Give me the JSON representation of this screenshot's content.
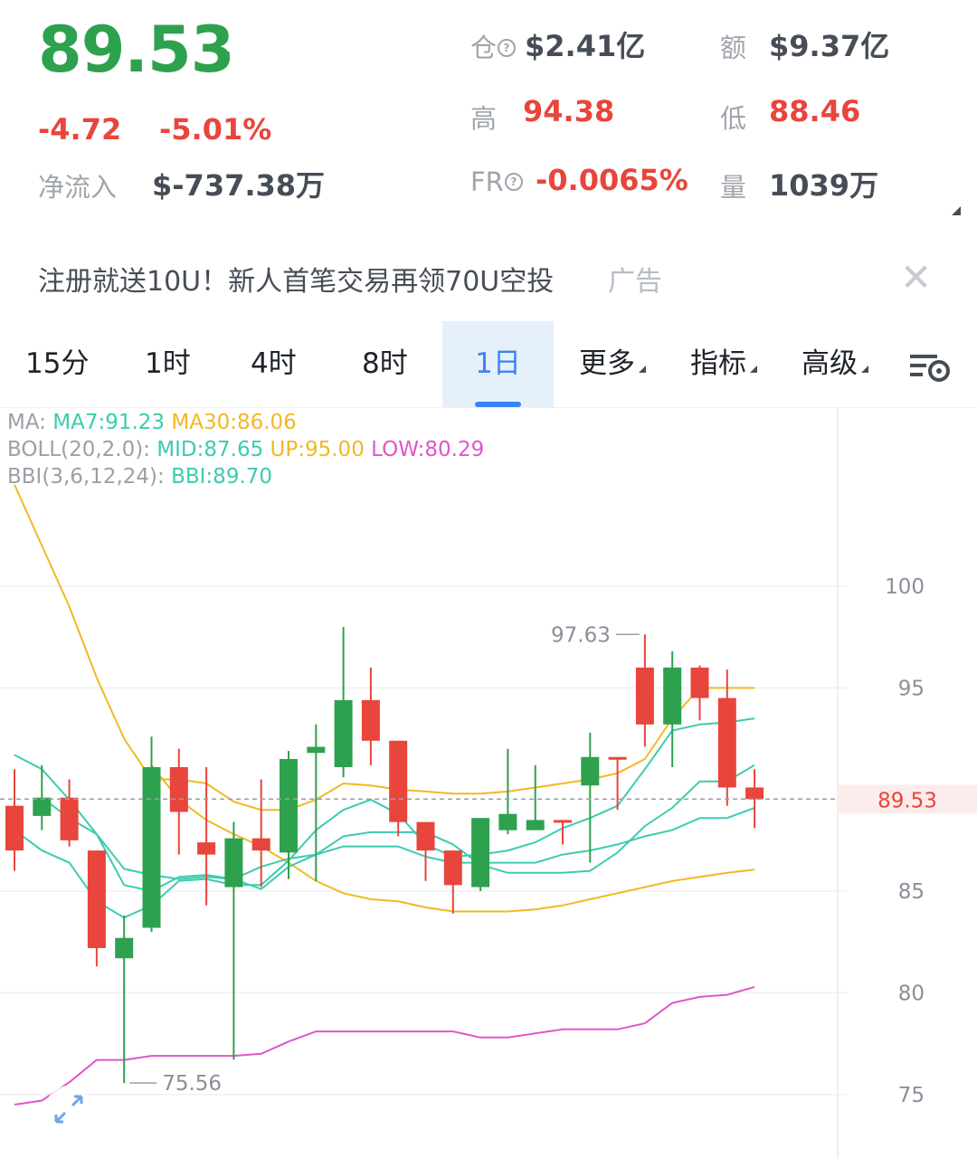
{
  "ticker": {
    "last_price": "89.53",
    "change": "-4.72",
    "change_pct": "-5.01%",
    "netflow_label": "净流入",
    "netflow_value": "$-737.38万"
  },
  "stats": {
    "oi_label": "仓",
    "oi_value": "$2.41亿",
    "amount_label": "额",
    "amount_value": "$9.37亿",
    "high_label": "高",
    "high_value": "94.38",
    "low_label": "低",
    "low_value": "88.46",
    "fr_label": "FR",
    "fr_value": "-0.0065%",
    "volume_label": "量",
    "volume_value": "1039万"
  },
  "ad": {
    "text": "注册就送10U！新人首笔交易再领70U空投",
    "tag": "广告"
  },
  "tabs": [
    {
      "label": "15分"
    },
    {
      "label": "1时"
    },
    {
      "label": "4时"
    },
    {
      "label": "8时"
    },
    {
      "label": "1日",
      "active": true
    },
    {
      "label": "更多"
    },
    {
      "label": "指标"
    },
    {
      "label": "高级"
    }
  ],
  "indicators": {
    "ma_label": "MA:",
    "ma7": "MA7:91.23",
    "ma30": "MA30:86.06",
    "boll_label": "BOLL(20,2.0):",
    "boll_mid": "MID:87.65",
    "boll_up": "UP:95.00",
    "boll_low": "LOW:80.29",
    "bbi_label": "BBI(3,6,12,24):",
    "bbi_value": "BBI:89.70"
  },
  "colors": {
    "up": "#2ea14e",
    "down": "#e8453c",
    "ma7": "#3ccbb0",
    "ma30": "#f2b824",
    "boll_low": "#e056c6",
    "accent": "#3b82f6"
  },
  "chart_data": {
    "type": "candlestick",
    "y_ticks": [
      "100",
      "95",
      "85",
      "80",
      "75"
    ],
    "current_price_label": "89.53",
    "max_label": "97.63",
    "min_label": "75.56",
    "ylim": [
      73,
      103
    ],
    "candles": [
      {
        "o": 89.2,
        "c": 87.0,
        "h": 91.0,
        "l": 86.0
      },
      {
        "o": 88.7,
        "c": 89.6,
        "h": 91.2,
        "l": 88.0
      },
      {
        "o": 89.6,
        "c": 87.5,
        "h": 90.5,
        "l": 87.2
      },
      {
        "o": 87.0,
        "c": 82.2,
        "h": 87.0,
        "l": 81.3
      },
      {
        "o": 81.7,
        "c": 82.7,
        "h": 83.8,
        "l": 75.56
      },
      {
        "o": 83.2,
        "c": 91.1,
        "h": 92.6,
        "l": 83.0
      },
      {
        "o": 91.1,
        "c": 88.9,
        "h": 92.0,
        "l": 86.8
      },
      {
        "o": 87.4,
        "c": 86.8,
        "h": 91.1,
        "l": 84.3
      },
      {
        "o": 85.2,
        "c": 87.6,
        "h": 88.4,
        "l": 76.7
      },
      {
        "o": 87.6,
        "c": 87.0,
        "h": 90.5,
        "l": 85.2
      },
      {
        "o": 86.9,
        "c": 91.5,
        "h": 91.9,
        "l": 85.6
      },
      {
        "o": 91.8,
        "c": 92.1,
        "h": 93.2,
        "l": 85.5
      },
      {
        "o": 91.1,
        "c": 94.4,
        "h": 98.0,
        "l": 90.6
      },
      {
        "o": 94.4,
        "c": 92.4,
        "h": 96.0,
        "l": 91.2
      },
      {
        "o": 92.4,
        "c": 88.4,
        "h": 92.4,
        "l": 87.7
      },
      {
        "o": 88.4,
        "c": 87.0,
        "h": 88.4,
        "l": 85.5
      },
      {
        "o": 87.0,
        "c": 85.3,
        "h": 87.0,
        "l": 83.9
      },
      {
        "o": 85.2,
        "c": 88.6,
        "h": 88.6,
        "l": 85.0
      },
      {
        "o": 88.0,
        "c": 88.8,
        "h": 92.0,
        "l": 87.8
      },
      {
        "o": 88.0,
        "c": 88.5,
        "h": 91.2,
        "l": 88.0
      },
      {
        "o": 88.5,
        "c": 88.4,
        "h": 88.5,
        "l": 87.3
      },
      {
        "o": 90.2,
        "c": 91.6,
        "h": 92.8,
        "l": 86.4
      },
      {
        "o": 91.6,
        "c": 91.5,
        "h": 91.5,
        "l": 89.0
      },
      {
        "o": 96.0,
        "c": 93.2,
        "h": 97.63,
        "l": 92.1
      },
      {
        "o": 93.2,
        "c": 96.0,
        "h": 96.8,
        "l": 91.1
      },
      {
        "o": 96.0,
        "c": 94.5,
        "h": 96.1,
        "l": 93.4
      },
      {
        "o": 94.5,
        "c": 90.1,
        "h": 95.9,
        "l": 89.2
      },
      {
        "o": 90.1,
        "c": 89.53,
        "h": 91.0,
        "l": 88.1
      }
    ],
    "lines": [
      {
        "color": "#f2b824",
        "values": [
          105,
          102,
          99,
          95.5,
          92.5,
          90.5,
          90.5,
          90.3,
          89.4,
          89.0,
          89.0,
          89.5,
          90.3,
          90.2,
          90.0,
          89.9,
          89.8,
          89.8,
          89.9,
          90.1,
          90.3,
          90.5,
          90.8,
          91.5,
          93.5,
          95.0,
          95.0,
          95.0
        ]
      },
      {
        "color": "#f2b824",
        "values": [
          null,
          null,
          null,
          null,
          null,
          91.2,
          89.5,
          88.5,
          87.8,
          87.2,
          86.4,
          85.5,
          84.9,
          84.6,
          84.5,
          84.2,
          84.0,
          84.0,
          84.0,
          84.1,
          84.3,
          84.6,
          84.9,
          85.2,
          85.5,
          85.7,
          85.9,
          86.06
        ]
      },
      {
        "color": "#3ccbb0",
        "values": [
          88.0,
          87.0,
          86.4,
          84.5,
          83.7,
          84.3,
          85.5,
          85.6,
          85.3,
          85.3,
          86.5,
          88.0,
          89.0,
          89.5,
          88.8,
          87.3,
          86.7,
          86.8,
          87.0,
          87.4,
          88.1,
          88.6,
          89.2,
          91.0,
          92.9,
          93.2,
          93.3,
          93.5
        ]
      },
      {
        "color": "#3ccbb0",
        "values": [
          null,
          89.6,
          88.6,
          87.8,
          85.3,
          85.0,
          85.7,
          85.8,
          85.6,
          85.1,
          86.2,
          86.8,
          87.7,
          87.9,
          87.9,
          87.9,
          87.3,
          86.3,
          85.9,
          85.9,
          85.9,
          86.0,
          86.9,
          88.2,
          89.1,
          90.4,
          90.4,
          91.2
        ]
      },
      {
        "color": "#3ccbb0",
        "values": [
          91.7,
          91.0,
          89.5,
          87.8,
          86.1,
          85.8,
          85.6,
          85.7,
          85.6,
          86.2,
          86.6,
          86.8,
          87.2,
          87.2,
          87.2,
          86.7,
          86.4,
          86.4,
          86.4,
          86.4,
          86.8,
          87.0,
          87.3,
          87.7,
          88.0,
          88.6,
          88.6,
          89.1
        ]
      },
      {
        "color": "#e056c6",
        "values": [
          74.5,
          74.7,
          75.6,
          76.7,
          76.7,
          76.9,
          76.9,
          76.9,
          76.9,
          77.0,
          77.6,
          78.1,
          78.1,
          78.1,
          78.1,
          78.1,
          78.1,
          77.8,
          77.8,
          78.0,
          78.2,
          78.2,
          78.2,
          78.5,
          79.5,
          79.8,
          79.9,
          80.29
        ]
      }
    ]
  }
}
